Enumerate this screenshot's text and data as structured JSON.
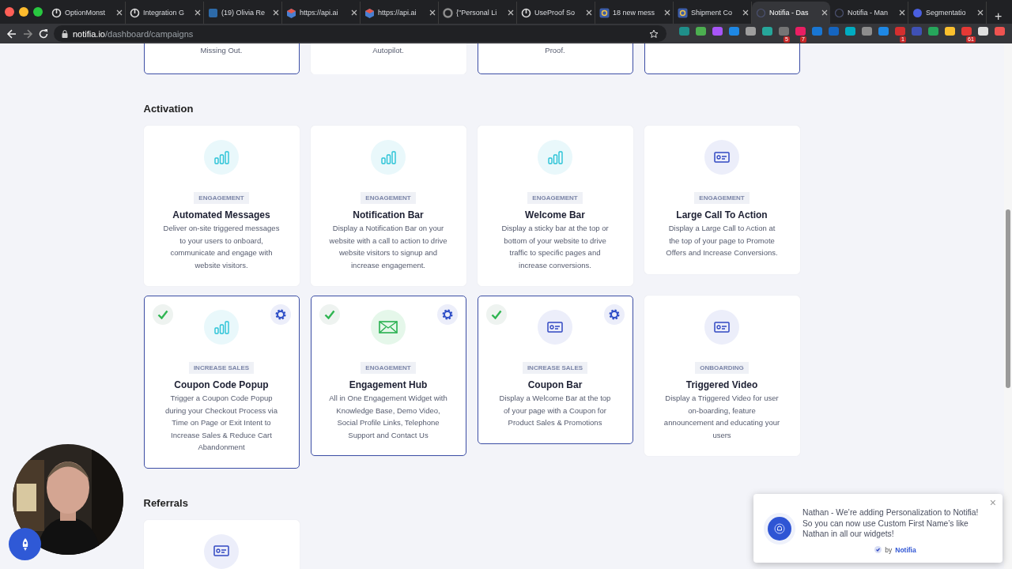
{
  "browser": {
    "tabs": [
      {
        "title": "OptionMonst",
        "kind": "power",
        "selected": false
      },
      {
        "title": "Integration G",
        "kind": "power",
        "selected": false
      },
      {
        "title": "(19) Olivia Re",
        "kind": "square",
        "selected": false
      },
      {
        "title": "https://api.ai",
        "kind": "cube",
        "selected": false
      },
      {
        "title": "https://api.ai",
        "kind": "cube",
        "selected": false
      },
      {
        "title": "{\"Personal Li",
        "kind": "ring",
        "selected": false
      },
      {
        "title": "UseProof So",
        "kind": "power",
        "selected": false
      },
      {
        "title": "18 new mess",
        "kind": "at",
        "selected": false
      },
      {
        "title": "Shipment Co",
        "kind": "at",
        "selected": false
      },
      {
        "title": "Notifia - Das",
        "kind": "dot",
        "selected": true
      },
      {
        "title": "Notifia - Man",
        "kind": "dot",
        "selected": false
      },
      {
        "title": "Segmentatio",
        "kind": "disc",
        "selected": false
      }
    ],
    "new_tab": "+",
    "address": {
      "host": "notifia.io",
      "path": "/dashboard/campaigns"
    },
    "extensions": [
      {
        "color": "#1f8f8a"
      },
      {
        "color": "#4caf50"
      },
      {
        "color": "#a855f7"
      },
      {
        "color": "#1e88e5"
      },
      {
        "color": "#9e9e9e"
      },
      {
        "color": "#26a69a"
      },
      {
        "color": "#757575",
        "badge": "5"
      },
      {
        "color": "#e91e63",
        "badge": "7"
      },
      {
        "color": "#1976d2"
      },
      {
        "color": "#1565c0"
      },
      {
        "color": "#00acc1"
      },
      {
        "color": "#8d8d8d"
      },
      {
        "color": "#1e88e5"
      },
      {
        "color": "#d32f2f",
        "badge": "1"
      },
      {
        "color": "#3f51b5"
      },
      {
        "color": "#26a65b"
      },
      {
        "color": "#fbc02d"
      },
      {
        "color": "#e53935",
        "badge": "61"
      },
      {
        "color": "#e0e0e0"
      },
      {
        "color": "#ef5350"
      }
    ]
  },
  "top_cards": [
    {
      "last_line": "Missing Out.",
      "active": true
    },
    {
      "last_line": "Autopilot.",
      "active": false
    },
    {
      "last_line": "Proof.",
      "active": true
    },
    {
      "active": true
    }
  ],
  "sections": [
    {
      "title": "Activation",
      "cards": [
        {
          "kind": "chart",
          "category": "ENGAGEMENT",
          "title": "Automated Messages",
          "description": "Deliver on-site triggered messages to your users to onboard, communicate and engage with website visitors.",
          "active": false
        },
        {
          "kind": "chart",
          "category": "ENGAGEMENT",
          "title": "Notification Bar",
          "description": "Display a Notification Bar on your website with a call to action to drive website visitors to signup and increase engagement.",
          "active": false
        },
        {
          "kind": "chart",
          "category": "ENGAGEMENT",
          "title": "Welcome Bar",
          "description": "Display a sticky bar at the top or bottom of your website to drive traffic to specific pages and increase conversions.",
          "active": false
        },
        {
          "kind": "card",
          "category": "ENGAGEMENT",
          "title": "Large Call To Action",
          "description": "Display a Large Call to Action at the top of your page to Promote Offers and Increase Conversions.",
          "active": false
        },
        {
          "kind": "chart",
          "category": "INCREASE SALES",
          "title": "Coupon Code Popup",
          "description": "Trigger a Coupon Code Popup during your Checkout Process via Time on Page or Exit Intent to Increase Sales & Reduce Cart Abandonment",
          "active": true
        },
        {
          "kind": "mail",
          "category": "ENGAGEMENT",
          "title": "Engagement Hub",
          "description": "All in One Engagement Widget with Knowledge Base, Demo Video, Social Profile Links, Telephone Support and Contact Us",
          "active": true
        },
        {
          "kind": "card",
          "category": "INCREASE SALES",
          "title": "Coupon Bar",
          "description": "Display a Welcome Bar at the top of your page with a Coupon for Product Sales & Promotions",
          "active": true
        },
        {
          "kind": "card",
          "category": "ONBOARDING",
          "title": "Triggered Video",
          "description": "Display a Triggered Video for user on-boarding, feature announcement and educating your users",
          "active": false
        }
      ]
    },
    {
      "title": "Referrals",
      "cards": [
        {
          "kind": "card",
          "active": false
        }
      ]
    }
  ],
  "notification": {
    "message": "Nathan - We’re adding Personalization to Notifia! So you can now use Custom First Name’s like Nathan in all our widgets!",
    "credit_prefix": "by",
    "credit_brand": "Notifia",
    "close": "×"
  }
}
